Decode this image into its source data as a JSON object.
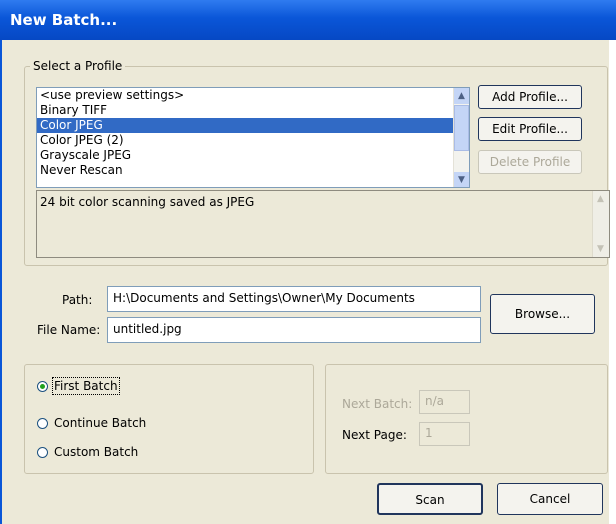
{
  "window": {
    "title": "New Batch..."
  },
  "profile_group": {
    "legend": "Select a Profile",
    "items": [
      "<use preview settings>",
      "Binary TIFF",
      "Color JPEG",
      "Color JPEG (2)",
      "Grayscale JPEG",
      "Never Rescan"
    ],
    "selected_index": 2,
    "description": "24 bit color scanning saved as JPEG",
    "add_label": "Add Profile...",
    "edit_label": "Edit Profile...",
    "delete_label": "Delete Profile"
  },
  "file": {
    "path_label": "Path:",
    "path_value": "H:\\Documents and Settings\\Owner\\My Documents",
    "name_label": "File Name:",
    "name_value": "untitled.jpg",
    "browse_label": "Browse..."
  },
  "batch": {
    "options": [
      "First Batch",
      "Continue Batch",
      "Custom Batch"
    ],
    "selected_index": 0,
    "next_batch_label": "Next Batch:",
    "next_batch_value": "n/a",
    "next_page_label": "Next Page:",
    "next_page_value": "1"
  },
  "actions": {
    "scan_label": "Scan",
    "cancel_label": "Cancel"
  },
  "icons": {
    "scroll_up": "scroll-up-arrow-icon",
    "scroll_down": "scroll-down-arrow-icon",
    "radio_selected": "radio-selected-icon"
  },
  "colors": {
    "titlebar": "#0a56d8",
    "dialog_face": "#ece9d8",
    "selection": "#316ac5",
    "radio_dot": "#21a121"
  }
}
